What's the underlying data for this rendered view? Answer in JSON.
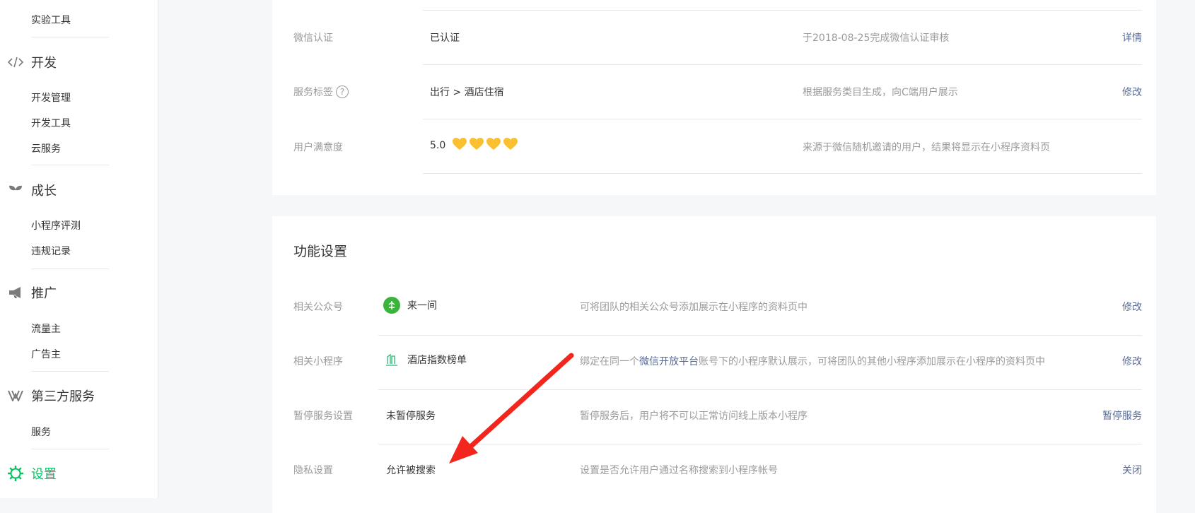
{
  "sidebar": {
    "top_item": "实验工具",
    "sections": [
      {
        "title": "开发",
        "icon": "code-icon",
        "items": [
          "开发管理",
          "开发工具",
          "云服务"
        ]
      },
      {
        "title": "成长",
        "icon": "sprout-icon",
        "items": [
          "小程序评测",
          "违规记录"
        ]
      },
      {
        "title": "推广",
        "icon": "megaphone-icon",
        "items": [
          "流量主",
          "广告主"
        ]
      },
      {
        "title": "第三方服务",
        "icon": "third-party-icon",
        "items": [
          "服务"
        ]
      },
      {
        "title": "设置",
        "icon": "settings-gear-icon",
        "items": []
      }
    ]
  },
  "basic_info": {
    "rows": [
      {
        "label": "微信认证",
        "value": "已认证",
        "desc": "于2018-08-25完成微信认证审核",
        "action": "详情"
      },
      {
        "label": "服务标签",
        "help": "?",
        "value": "出行 > 酒店住宿",
        "desc": "根据服务类目生成，向C端用户展示",
        "action": "修改"
      },
      {
        "label": "用户满意度",
        "value": "5.0",
        "hearts": 4,
        "desc": "来源于微信随机邀请的用户，结果将显示在小程序资料页",
        "action": ""
      }
    ]
  },
  "function_settings": {
    "title": "功能设置",
    "rows": [
      {
        "label": "相关公众号",
        "value": "来一间",
        "desc": "可将团队的相关公众号添加展示在小程序的资料页中",
        "action": "修改"
      },
      {
        "label": "相关小程序",
        "value": "酒店指数榜单",
        "desc_pre": "绑定在同一个",
        "desc_link": "微信开放平台",
        "desc_post": "账号下的小程序默认展示，可将团队的其他小程序添加展示在小程序的资料页中",
        "action": "修改"
      },
      {
        "label": "暂停服务设置",
        "value": "未暂停服务",
        "desc": "暂停服务后，用户将不可以正常访问线上版本小程序",
        "action": "暂停服务"
      },
      {
        "label": "隐私设置",
        "value": "允许被搜索",
        "desc": "设置是否允许用户通过名称搜索到小程序帐号",
        "action": "关闭"
      }
    ]
  },
  "colors": {
    "accent": "#07c160",
    "link": "#576b95",
    "heart": "#fbc02d",
    "arrow": "#f2261c"
  }
}
